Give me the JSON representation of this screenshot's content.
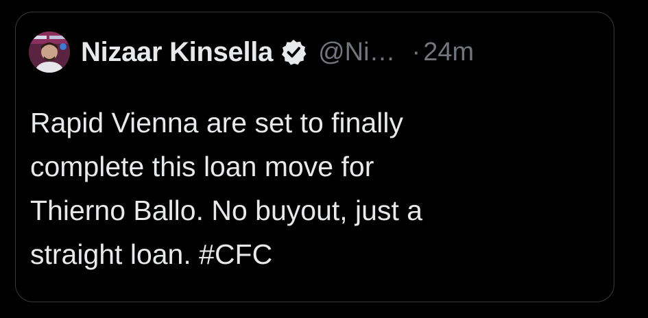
{
  "tweet": {
    "author": {
      "display_name": "Nizaar Kinsella",
      "handle": "@Ni…",
      "verified": true,
      "avatar": "avatar-photo"
    },
    "separator": "·",
    "timestamp": "24m",
    "text_lines": [
      "Rapid Vienna are set to finally",
      "complete this loan move for",
      "Thierno Ballo. No buyout, just a",
      "straight loan. #CFC"
    ]
  },
  "colors": {
    "background": "#000000",
    "border": "#38393d",
    "primary_text": "#e7e9ea",
    "secondary_text": "#71767b",
    "verified_badge": "#e7e9ea"
  },
  "icons": {
    "verified": "verified-badge-icon"
  }
}
